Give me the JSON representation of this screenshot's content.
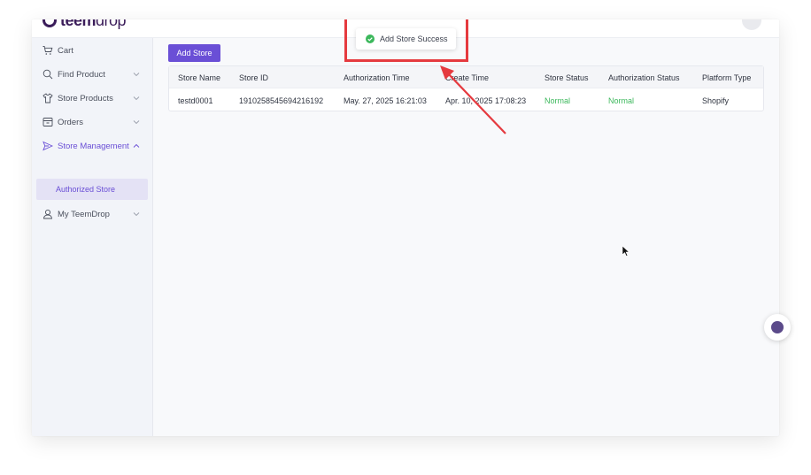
{
  "brand": {
    "logo_strong": "teem",
    "logo_light": "drop"
  },
  "sidebar": {
    "items": [
      {
        "label": "Cart",
        "icon": "cart-icon"
      },
      {
        "label": "Find Product",
        "icon": "search-icon"
      },
      {
        "label": "Store Products",
        "icon": "shirt-icon"
      },
      {
        "label": "Orders",
        "icon": "orders-icon"
      },
      {
        "label": "Store Management",
        "icon": "send-icon"
      },
      {
        "label": "My TeemDrop",
        "icon": "user-icon"
      }
    ],
    "sub_item": {
      "label": "Authorized Store"
    }
  },
  "main": {
    "add_store_label": "Add Store"
  },
  "table": {
    "headers": [
      "Store Name",
      "Store ID",
      "Authorization Time",
      "Create Time",
      "Store Status",
      "Authorization Status",
      "Platform Type"
    ],
    "rows": [
      [
        "testd0001",
        "1910258545694216192",
        "May. 27, 2025 16:21:03",
        "Apr. 10, 2025 17:08:23",
        "Normal",
        "Normal",
        "Shopify"
      ]
    ]
  },
  "toast": {
    "message": "Add Store Success",
    "icon": "check-circle-icon"
  },
  "colors": {
    "accent": "#6a4fd6",
    "success": "#3cb85c",
    "annotation": "#e53a3f"
  }
}
